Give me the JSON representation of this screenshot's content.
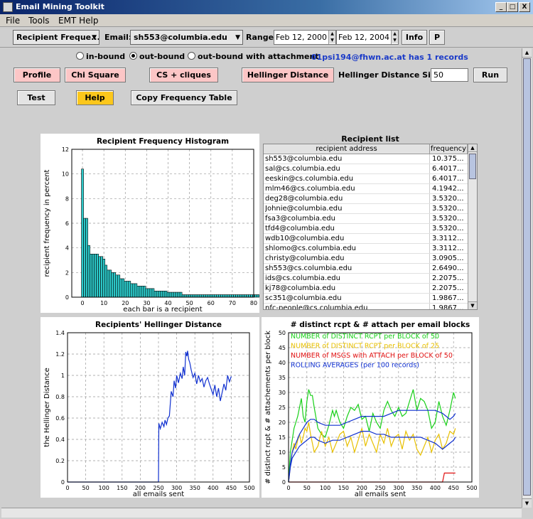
{
  "window": {
    "title": "Email Mining Toolkit",
    "min": "_",
    "max": "□",
    "close": "X"
  },
  "menu": [
    "File",
    "Tools",
    "EMT Help"
  ],
  "toolbar": {
    "view_select": "Recipient Freque...",
    "email_label": "Email:",
    "email_value": "sh553@columbia.edu",
    "range_label": "Range:",
    "date_from": "Feb 12, 2000",
    "date_to": "Feb 12, 2004",
    "info_label": "Info",
    "p_label": "P"
  },
  "direction": {
    "options": [
      "in-bound",
      "out-bound",
      "out-bound with attachment"
    ],
    "selected": 1,
    "note": "01psi194@fhwn.ac.at has 1 records"
  },
  "buttons": {
    "profile": "Profile",
    "chi_square": "Chi Square",
    "cs_cliques": "CS + cliques",
    "hellinger": "Hellinger Distance",
    "hellinger_size_label": "Hellinger Distance Size",
    "hellinger_size_value": "50",
    "run": "Run",
    "test": "Test",
    "help": "Help",
    "copy_table": "Copy Frequency Table"
  },
  "table": {
    "title": "Recipient list",
    "columns": [
      "recipient address",
      "frequency"
    ],
    "rows": [
      [
        "sh553@columbia.edu",
        "10.375..."
      ],
      [
        "sal@cs.columbia.edu",
        "6.4017..."
      ],
      [
        "eeskin@cs.columbia.edu",
        "6.4017..."
      ],
      [
        "mlm46@cs.columbia.edu",
        "4.1942..."
      ],
      [
        "deg28@columbia.edu",
        "3.5320..."
      ],
      [
        "Johnie@columbia.edu",
        "3.5320..."
      ],
      [
        "fsa3@columbia.edu",
        "3.5320..."
      ],
      [
        "tfd4@columbia.edu",
        "3.5320..."
      ],
      [
        "wdb10@columbia.edu",
        "3.3112..."
      ],
      [
        "shlomo@cs.columbia.edu",
        "3.3112..."
      ],
      [
        "christy@columbia.edu",
        "3.0905..."
      ],
      [
        "sh553@cs.columbia.edu",
        "2.6490..."
      ],
      [
        "ids@cs.columbia.edu",
        "2.2075..."
      ],
      [
        "kj78@columbia.edu",
        "2.2075..."
      ],
      [
        "sc351@columbia.edu",
        "1.9867..."
      ],
      [
        "nfc-people@cs.columbia.edu",
        "1.9867..."
      ]
    ]
  },
  "chart_data": [
    {
      "type": "bar",
      "title": "Recipient Frequency Histogram",
      "xlabel": "each bar is a recipient",
      "ylabel": "recipient frequency in percent",
      "xlim": [
        -5,
        80
      ],
      "ylim": [
        0,
        12
      ],
      "xticks": [
        0,
        10,
        20,
        30,
        40,
        50,
        60,
        70,
        80
      ],
      "yticks": [
        0,
        2,
        4,
        6,
        8,
        10,
        12
      ],
      "grid": true,
      "color": "#2cc9c9",
      "values": [
        10.4,
        6.4,
        6.4,
        4.2,
        3.5,
        3.5,
        3.5,
        3.5,
        3.3,
        3.3,
        3.1,
        2.6,
        2.2,
        2.2,
        2.0,
        2.0,
        1.8,
        1.8,
        1.5,
        1.5,
        1.3,
        1.3,
        1.3,
        1.1,
        1.1,
        1.1,
        0.9,
        0.9,
        0.9,
        0.9,
        0.7,
        0.7,
        0.7,
        0.7,
        0.5,
        0.5,
        0.5,
        0.5,
        0.5,
        0.5,
        0.4,
        0.4,
        0.4,
        0.4,
        0.4,
        0.4,
        0.4,
        0.2,
        0.2,
        0.2,
        0.2,
        0.2,
        0.2,
        0.2,
        0.2,
        0.2,
        0.2,
        0.2,
        0.2,
        0.2,
        0.2,
        0.2,
        0.2,
        0.2,
        0.2,
        0.2,
        0.2,
        0.2,
        0.2,
        0.2,
        0.2,
        0.2,
        0.2,
        0.2,
        0.2,
        0.2,
        0.2,
        0.2,
        0.2,
        0.2,
        0.2,
        0.2,
        0.2,
        0.2,
        0.2,
        0.2
      ]
    },
    {
      "type": "line",
      "title": "Recipients' Hellinger Distance",
      "xlabel": "all emails sent",
      "ylabel": "the Hellinger Distance",
      "xlim": [
        0,
        500
      ],
      "ylim": [
        0,
        1.4
      ],
      "xticks": [
        0,
        50,
        100,
        150,
        200,
        250,
        300,
        350,
        400,
        450,
        500
      ],
      "yticks": [
        0,
        0.2,
        0.4,
        0.6,
        0.8,
        1,
        1.2,
        1.4
      ],
      "grid": true,
      "series": [
        {
          "color": "#1030d0",
          "x": [
            0,
            248,
            250,
            251,
            255,
            260,
            265,
            268,
            272,
            276,
            280,
            285,
            290,
            293,
            297,
            300,
            305,
            310,
            315,
            318,
            322,
            325,
            328,
            330,
            333,
            336,
            340,
            345,
            350,
            355,
            360,
            365,
            370,
            375,
            380,
            385,
            390,
            395,
            400,
            405,
            410,
            415,
            420,
            425,
            430,
            435,
            440,
            445,
            450
          ],
          "y": [
            0,
            0,
            0,
            0.55,
            0.5,
            0.56,
            0.52,
            0.58,
            0.54,
            0.6,
            0.62,
            0.85,
            0.8,
            0.95,
            0.88,
            1.0,
            0.93,
            1.02,
            0.97,
            1.08,
            1.0,
            1.22,
            1.18,
            1.23,
            1.15,
            1.12,
            1.05,
            0.98,
            1.02,
            0.92,
            1.0,
            0.94,
            0.97,
            0.89,
            0.95,
            0.98,
            0.92,
            0.87,
            0.82,
            0.91,
            0.8,
            0.88,
            0.76,
            0.84,
            0.92,
            0.86,
            1.0,
            0.94,
            0.99
          ]
        }
      ]
    },
    {
      "type": "line",
      "title": "# distinct rcpt & # attach per email blocks",
      "xlabel": "all emails sent",
      "ylabel": "# distinct rcpt & # attachements per block",
      "xlim": [
        0,
        500
      ],
      "ylim": [
        0,
        50
      ],
      "xticks": [
        0,
        50,
        100,
        150,
        200,
        250,
        300,
        350,
        400,
        450,
        500
      ],
      "yticks": [
        0,
        5,
        10,
        15,
        20,
        25,
        30,
        35,
        40,
        45,
        50
      ],
      "grid": true,
      "legend": "top-left",
      "series": [
        {
          "name": "NUMBER of DISTINCT RCPT per BLOCK of 50",
          "color": "#18d018",
          "x": [
            0,
            5,
            10,
            15,
            20,
            25,
            30,
            35,
            40,
            45,
            50,
            55,
            60,
            65,
            70,
            80,
            90,
            100,
            110,
            120,
            125,
            130,
            140,
            150,
            160,
            170,
            180,
            190,
            200,
            210,
            220,
            230,
            240,
            250,
            260,
            270,
            280,
            290,
            300,
            310,
            320,
            330,
            340,
            350,
            360,
            370,
            380,
            390,
            400,
            410,
            420,
            430,
            440,
            450,
            455
          ],
          "y": [
            0,
            10,
            14,
            18,
            20,
            22,
            25,
            28,
            22,
            20,
            27,
            31,
            29,
            29,
            25,
            18,
            16,
            15,
            19,
            24,
            22,
            24,
            20,
            18,
            22,
            25,
            24,
            26,
            21,
            22,
            17,
            23,
            20,
            18,
            24,
            27,
            24,
            22,
            25,
            22,
            23,
            27,
            31,
            24,
            28,
            27,
            24,
            18,
            20,
            27,
            22,
            19,
            24,
            30,
            28
          ]
        },
        {
          "name": "NUMBER of DISTINCT RCPT per BLOCK of 25",
          "color": "#e8c000",
          "x": [
            0,
            5,
            10,
            15,
            20,
            25,
            30,
            35,
            40,
            45,
            50,
            55,
            60,
            65,
            70,
            80,
            90,
            100,
            110,
            120,
            130,
            140,
            150,
            160,
            170,
            180,
            190,
            200,
            210,
            220,
            230,
            240,
            250,
            260,
            270,
            280,
            290,
            300,
            310,
            320,
            330,
            340,
            350,
            360,
            370,
            380,
            390,
            400,
            410,
            420,
            430,
            440,
            450,
            455
          ],
          "y": [
            0,
            5,
            10,
            13,
            11,
            14,
            16,
            13,
            15,
            18,
            17,
            20,
            16,
            13,
            10,
            12,
            17,
            12,
            15,
            10,
            13,
            16,
            17,
            12,
            15,
            10,
            14,
            18,
            12,
            16,
            13,
            10,
            16,
            13,
            18,
            12,
            15,
            16,
            11,
            17,
            14,
            16,
            11,
            9,
            12,
            15,
            10,
            14,
            16,
            11,
            13,
            17,
            16,
            18
          ]
        },
        {
          "name": "NUMBER of MSGS with ATTACH per BLOCK of 50",
          "color": "#e01010",
          "x": [
            0,
            420,
            425,
            430,
            440,
            450,
            455
          ],
          "y": [
            0,
            0,
            3,
            3,
            3,
            3,
            3
          ]
        },
        {
          "name": "ROLLING AVERAGES (per 100 records)",
          "color": "#1030d0",
          "x": [
            0,
            5,
            10,
            20,
            30,
            40,
            50,
            60,
            70,
            80,
            100,
            120,
            140,
            160,
            180,
            200,
            220,
            240,
            250,
            260,
            280,
            300,
            320,
            340,
            360,
            380,
            400,
            420,
            430,
            440,
            450,
            455
          ],
          "y": [
            0,
            5,
            8,
            10,
            12,
            13,
            14,
            15,
            15,
            14,
            13,
            14,
            14,
            15,
            16,
            17,
            17,
            16,
            16,
            16,
            15,
            15,
            15,
            15,
            15,
            14,
            13,
            11,
            12,
            13,
            14,
            15
          ]
        },
        {
          "name": "ROLLING AVERAGES (per 100 records)",
          "color": "#1030d0",
          "x": [
            0,
            5,
            10,
            20,
            30,
            40,
            50,
            60,
            70,
            80,
            100,
            120,
            140,
            160,
            180,
            200,
            220,
            240,
            260,
            280,
            300,
            320,
            340,
            360,
            380,
            400,
            420,
            430,
            440,
            450,
            455
          ],
          "y": [
            0,
            6,
            10,
            13,
            16,
            18,
            20,
            21,
            21,
            20,
            19,
            19,
            19,
            20,
            21,
            22,
            22,
            22,
            22,
            23,
            24,
            24,
            24,
            24,
            24,
            24,
            23,
            22,
            21,
            22,
            23
          ]
        }
      ]
    }
  ]
}
